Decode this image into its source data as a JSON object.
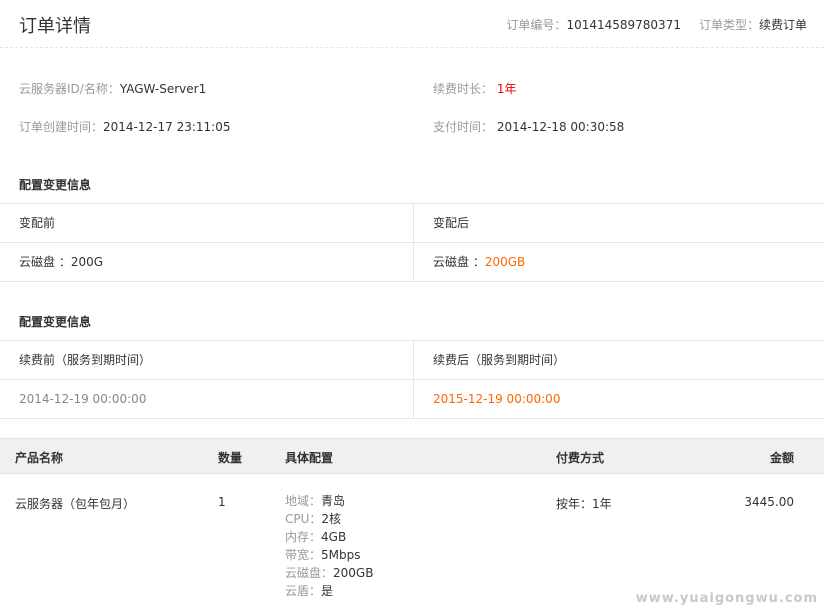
{
  "header": {
    "title": "订单详情",
    "order_no_label": "订单编号：",
    "order_no": "101414589780371",
    "order_type_label": "订单类型：",
    "order_type": "续费订单"
  },
  "info": {
    "server_label": "云服务器ID/名称：",
    "server_value": "YAGW-Server1",
    "duration_label": "续费时长：",
    "duration_value": "1年",
    "created_label": "订单创建时间：",
    "created_value": "2014-12-17 23:11:05",
    "paid_label": "支付时间：",
    "paid_value": "2014-12-18 00:30:58"
  },
  "config_change": {
    "title": "配置变更信息",
    "before_header": "变配前",
    "after_header": "变配后",
    "before_label": "云磁盘 ：",
    "before_value": "200G",
    "after_label": "云磁盘 ：",
    "after_value": "200GB"
  },
  "renew_change": {
    "title": "配置变更信息",
    "before_header": "续费前（服务到期时间）",
    "after_header": "续费后（服务到期时间）",
    "before_value": "2014-12-19 00:00:00",
    "after_value": "2015-12-19 00:00:00"
  },
  "product_table": {
    "headers": {
      "name": "产品名称",
      "qty": "数量",
      "spec": "具体配置",
      "payment": "付费方式",
      "amount": "金额"
    },
    "row": {
      "name": "云服务器（包年包月）",
      "qty": "1",
      "specs": [
        {
          "k": "地域：",
          "v": "青岛"
        },
        {
          "k": "CPU：",
          "v": "2核"
        },
        {
          "k": "内存：",
          "v": "4GB"
        },
        {
          "k": "带宽：",
          "v": "5Mbps"
        },
        {
          "k": "云磁盘：",
          "v": "200GB"
        },
        {
          "k": "云盾：",
          "v": "是"
        }
      ],
      "payment": "按年：1年",
      "amount": "3445.00"
    }
  },
  "watermark": "www.yuaigongwu.com",
  "colors": {
    "highlight_red": "#ee0000",
    "highlight_orange": "#ff6600",
    "header_bg": "#f0f0f0"
  }
}
